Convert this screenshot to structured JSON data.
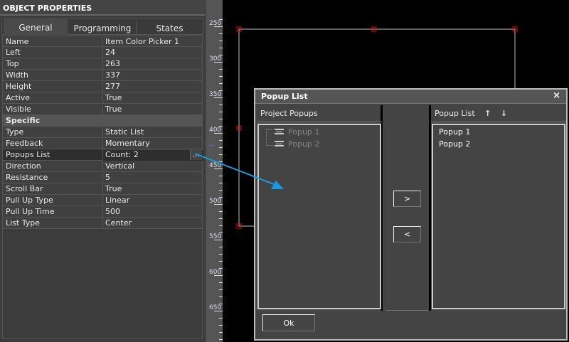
{
  "panel": {
    "title": "OBJECT PROPERTIES",
    "tabs": [
      "General",
      "Programming",
      "States"
    ],
    "general": [
      [
        "Name",
        "Item Color Picker 1"
      ],
      [
        "Left",
        "24"
      ],
      [
        "Top",
        "263"
      ],
      [
        "Width",
        "337"
      ],
      [
        "Height",
        "277"
      ],
      [
        "Active",
        "True"
      ],
      [
        "Visible",
        "True"
      ]
    ],
    "section": "Specific",
    "specific": [
      [
        "Type",
        "Static List"
      ],
      [
        "Feedback",
        "Momentary"
      ],
      [
        "Popups List",
        "Count: 2"
      ],
      [
        "Direction",
        "Vertical"
      ],
      [
        "Resistance",
        "5"
      ],
      [
        "Scroll Bar",
        "True"
      ],
      [
        "Pull Up Type",
        "Linear"
      ],
      [
        "Pull Up Time",
        "500"
      ],
      [
        "List Type",
        "Center"
      ]
    ],
    "ellipsis": "..."
  },
  "ruler": [
    "250",
    "300",
    "350",
    "400",
    "450",
    "500",
    "550",
    "600",
    "650"
  ],
  "dialog": {
    "title": "Popup List",
    "close": "×",
    "left_header": "Project Popups",
    "project_popups": [
      "Popup 1",
      "Popup 2"
    ],
    "right_header": "Popup List",
    "popup_list": [
      "Popup 1",
      "Popup 2"
    ],
    "add": ">",
    "remove": "<",
    "ok": "Ok",
    "up": "↑",
    "down": "↓"
  },
  "colors": {
    "arrow": "#1a9be0",
    "handle": "#ff0000"
  }
}
